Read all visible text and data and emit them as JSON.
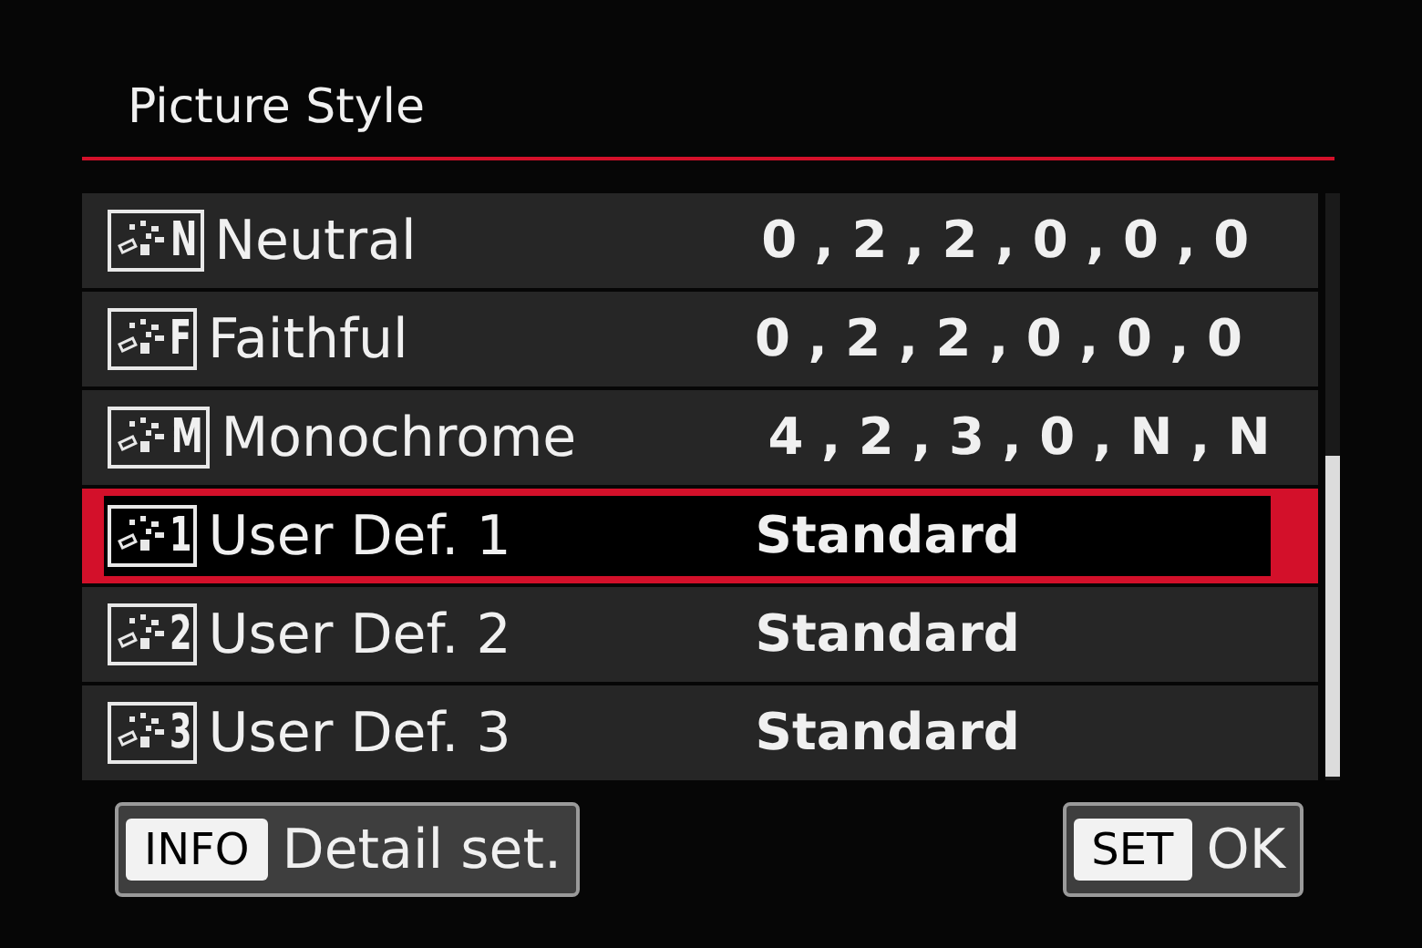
{
  "title": "Picture Style",
  "styles": [
    {
      "code": "N",
      "name": "Neutral",
      "value": "0 , 2 , 2 , 0 , 0 , 0",
      "selected": false
    },
    {
      "code": "F",
      "name": "Faithful",
      "value": "0 , 2 , 2 , 0 , 0 , 0",
      "selected": false
    },
    {
      "code": "M",
      "name": "Monochrome",
      "value": "4 , 2 , 3 , 0 , N , N",
      "selected": false
    },
    {
      "code": "1",
      "name": "User Def. 1",
      "value": "Standard",
      "selected": true
    },
    {
      "code": "2",
      "name": "User Def. 2",
      "value": "Standard",
      "selected": false
    },
    {
      "code": "3",
      "name": "User Def. 3",
      "value": "Standard",
      "selected": false
    }
  ],
  "buttons": [
    {
      "key": "INFO",
      "label": "Detail set."
    },
    {
      "key": "SET",
      "label": "OK"
    }
  ]
}
